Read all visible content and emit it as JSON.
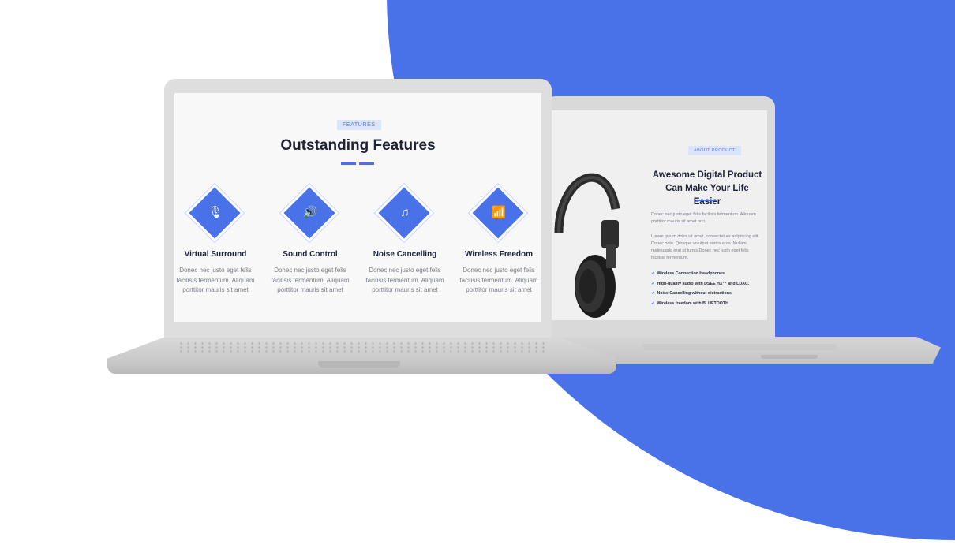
{
  "colors": {
    "accent": "#4a72e8",
    "background": "#ffffff"
  },
  "features_screen": {
    "badge": "FEATURES",
    "title": "Outstanding Features",
    "items": [
      {
        "icon": "microphone-icon",
        "glyph": "🎙",
        "name": "Virtual Surround",
        "text": "Donec nec justo eget felis facilisis fermentum. Aliquam porttitor mauris sit amet"
      },
      {
        "icon": "speaker-icon",
        "glyph": "🔊",
        "name": "Sound Control",
        "text": "Donec nec justo eget felis facilisis fermentum. Aliquam porttitor mauris sit amet"
      },
      {
        "icon": "music-note-icon",
        "glyph": "♫",
        "name": "Noise Cancelling",
        "text": "Donec nec justo eget felis facilisis fermentum. Aliquam porttitor mauris sit amet"
      },
      {
        "icon": "wifi-icon",
        "glyph": "📶",
        "name": "Wireless Freedom",
        "text": "Donec nec justo eget felis facilisis fermentum. Aliquam porttitor mauris sit amet"
      }
    ]
  },
  "about_screen": {
    "badge": "ABOUT PRODUCT",
    "title": "Awesome Digital Product Can Make Your Life Easier",
    "paragraph_1": "Donec nec justo eget felis facilisis fermentum. Aliquam porttitor mauris sit amet orci.",
    "paragraph_2": "Lorem ipsum dolor sit amet, consectetuer adipiscing elit. Donec odio. Quisque volutpat mattis eros. Nullam malesuada erat ut turpis.Donec nec justo eget felis facilisis fermentum.",
    "list": [
      "Wireless Connection Headphones",
      "High-quality audio with DSEE HX™ and LDAC.",
      "Noise Cancelling without distractions.",
      "Wireless freedom with BLUETOOTH"
    ]
  }
}
